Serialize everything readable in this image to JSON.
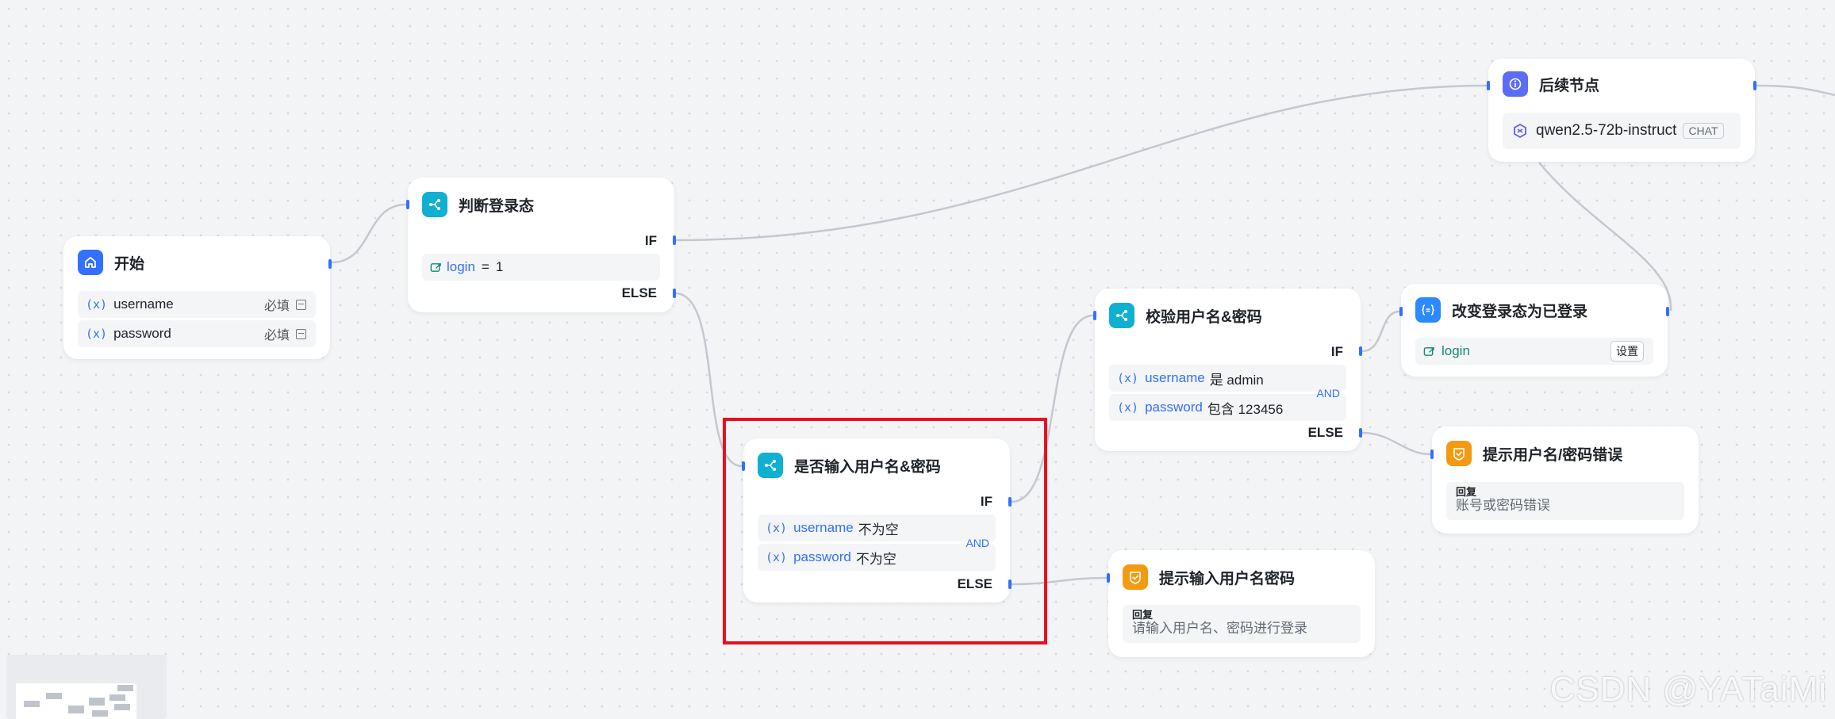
{
  "nodes": {
    "start": {
      "title": "开始",
      "vars": [
        {
          "icon": "(x)",
          "name": "username",
          "required": "必填"
        },
        {
          "icon": "(x)",
          "name": "password",
          "required": "必填"
        }
      ]
    },
    "check_login": {
      "title": "判断登录态",
      "if_label": "IF",
      "else_label": "ELSE",
      "condition": {
        "name": "login",
        "op": "=",
        "value": "1"
      }
    },
    "check_input": {
      "title": "是否输入用户名&密码",
      "if_label": "IF",
      "else_label": "ELSE",
      "and_label": "AND",
      "conditions": [
        {
          "icon": "(x)",
          "name": "username",
          "op": "不为空"
        },
        {
          "icon": "(x)",
          "name": "password",
          "op": "不为空"
        }
      ]
    },
    "verify": {
      "title": "校验用户名&密码",
      "if_label": "IF",
      "else_label": "ELSE",
      "and_label": "AND",
      "conditions": [
        {
          "icon": "(x)",
          "name": "username",
          "op": "是 admin"
        },
        {
          "icon": "(x)",
          "name": "password",
          "op": "包含 123456"
        }
      ]
    },
    "set_login": {
      "title": "改变登录态为已登录",
      "var": "login",
      "button": "设置"
    },
    "next": {
      "title": "后续节点",
      "model": "qwen2.5-72b-instruct",
      "badge": "CHAT"
    },
    "reply_error": {
      "title": "提示用户名/密码错误",
      "reply_label": "回复",
      "reply_text": "账号或密码错误"
    },
    "reply_input": {
      "title": "提示输入用户名密码",
      "reply_label": "回复",
      "reply_text": "请输入用户名、密码进行登录"
    }
  },
  "watermark": "CSDN @YATaiMi",
  "colors": {
    "accent": "#3370ff",
    "branch_icon": "#0fb0d2",
    "reply_icon": "#f39a13",
    "highlight": "#e8101e",
    "edge": "#c4c8cf"
  }
}
